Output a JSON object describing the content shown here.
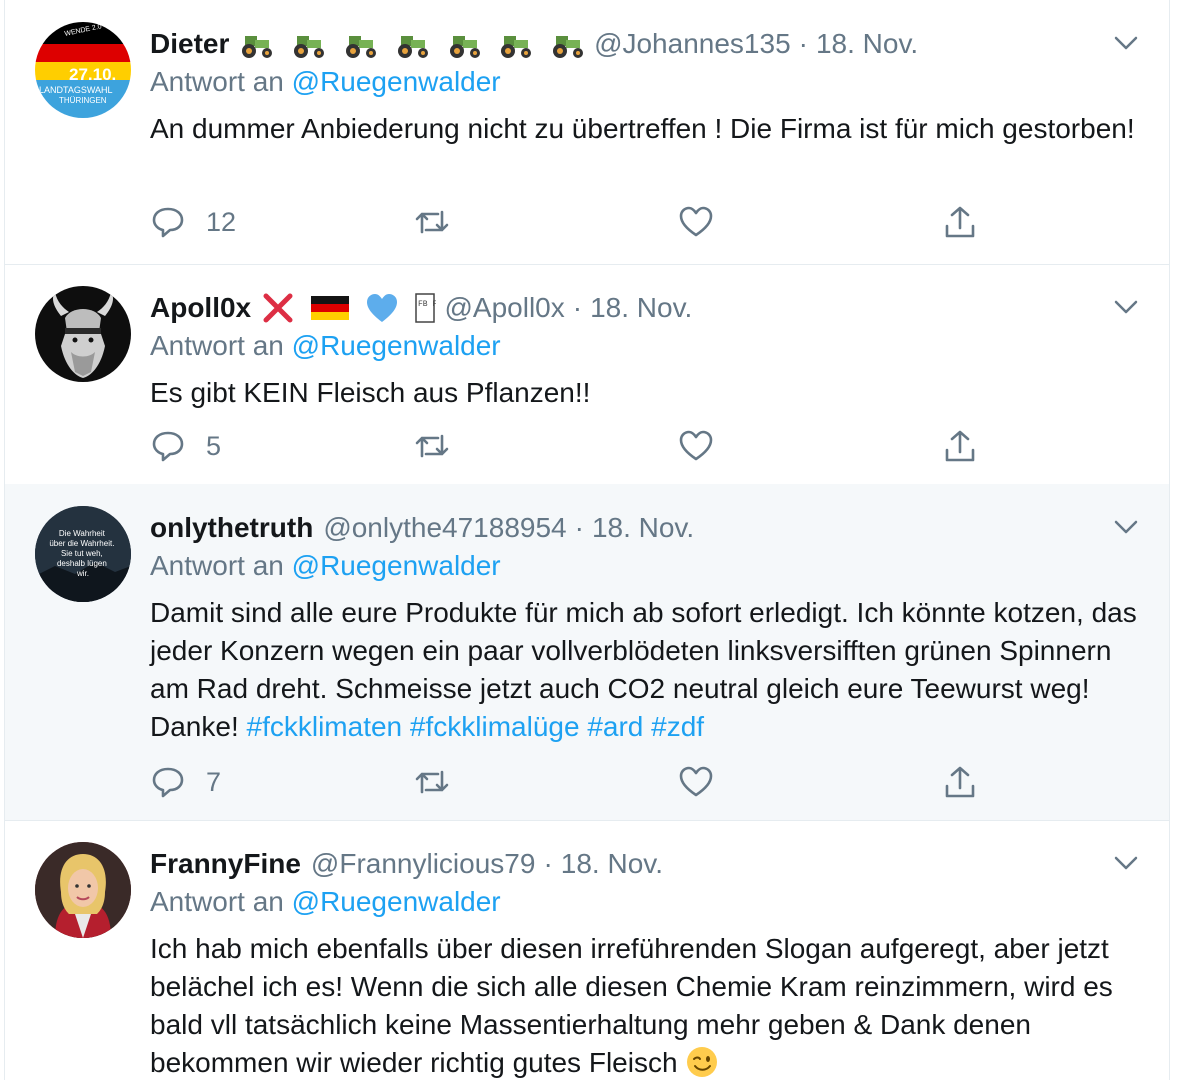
{
  "tweets": [
    {
      "name": "Dieter",
      "handle": "@Johannes135",
      "date": "18. Nov.",
      "reply_prefix": "Antwort an",
      "reply_to": "@Ruegenwalder",
      "text": "An dummer Anbiederung nicht zu übertreffen ! Die Firma ist für mich gestorben!",
      "replies": "12",
      "retweets": "",
      "likes": "",
      "avatar_text": {
        "top": "WENDE 2.0",
        "date": "27.10.",
        "line1": "LANDTAGSWAHL",
        "line2": "THÜRINGEN"
      },
      "name_emojis": [
        "tractor-icon",
        "tractor-icon",
        "tractor-icon",
        "tractor-icon",
        "tractor-icon",
        "tractor-icon",
        "tractor-icon"
      ]
    },
    {
      "name": "Apoll0x",
      "handle": "@Apoll0x",
      "date": "18. Nov.",
      "reply_prefix": "Antwort an",
      "reply_to": "@Ruegenwalder",
      "text": "Es gibt KEIN Fleisch aus Pflanzen!!",
      "replies": "5",
      "retweets": "",
      "likes": "",
      "name_emojis": [
        "cross-mark-icon",
        "german-flag-icon",
        "blue-heart-icon",
        "missing-glyph-icon"
      ],
      "missing_glyph": "FB FF"
    },
    {
      "name": "onlythetruth",
      "handle": "@onlythe47188954",
      "date": "18. Nov.",
      "reply_prefix": "Antwort an",
      "reply_to": "@Ruegenwalder",
      "text_plain": "Damit sind alle eure Produkte für mich ab sofort erledigt. Ich könnte kotzen, das jeder Konzern wegen ein paar vollverblödeten linksversifften grünen Spinnern am Rad dreht. Schmeisse jetzt auch CO2 neutral gleich eure Teewurst weg! Danke! ",
      "hashtags": [
        "#fckklimaten",
        "#fckklimalüge",
        "#ard",
        "#zdf"
      ],
      "replies": "7",
      "retweets": "",
      "likes": "",
      "avatar_text": [
        "Die Wahrheit",
        "über die Wahrheit.",
        "Sie tut weh,",
        "deshalb lügen",
        "wir."
      ]
    },
    {
      "name": "FrannyFine",
      "handle": "@Frannylicious79",
      "date": "18. Nov.",
      "reply_prefix": "Antwort an",
      "reply_to": "@Ruegenwalder",
      "text": "Ich hab mich ebenfalls über diesen irreführenden Slogan aufgeregt, aber jetzt belächel ich es! Wenn die sich alle diesen Chemie Kram reinzimmern, wird es bald vll tatsächlich keine Massentierhaltung mehr geben & Dank denen bekommen wir wieder richtig gutes Fleisch",
      "trailing_emoji": "winking-face-icon"
    }
  ],
  "colors": {
    "accent": "#1da1f2",
    "secondary_text": "#657786",
    "highlight_bg": "#f5f8fa",
    "divider": "#e6ecf0"
  }
}
